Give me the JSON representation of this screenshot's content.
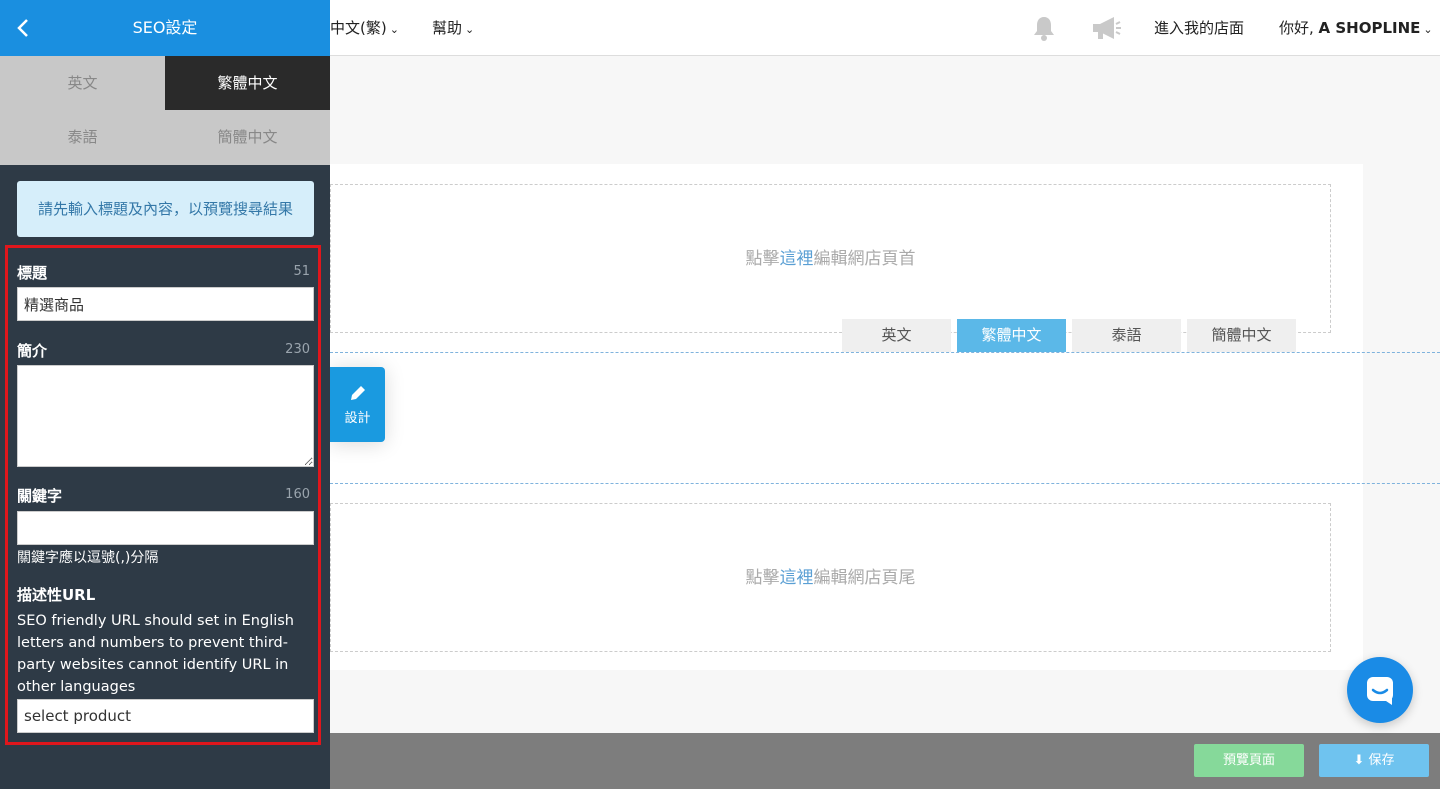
{
  "topbar": {
    "language": "中文(繁)",
    "help": "幫助",
    "enter_store": "進入我的店面",
    "greeting_prefix": "你好, ",
    "greeting_name": "A SHOPLINE"
  },
  "side_panel": {
    "title": "SEO設定",
    "tabs": [
      {
        "label": "英文",
        "active": false
      },
      {
        "label": "繁體中文",
        "active": true
      },
      {
        "label": "泰語",
        "active": false
      },
      {
        "label": "簡體中文",
        "active": false
      }
    ],
    "info": "請先輸入標題及內容，以預覽搜尋結果",
    "fields": {
      "title": {
        "label": "標題",
        "count": "51",
        "value": "精選商品"
      },
      "description": {
        "label": "簡介",
        "count": "230",
        "value": ""
      },
      "keywords": {
        "label": "關鍵字",
        "count": "160",
        "value": "",
        "hint": "關鍵字應以逗號(,)分隔"
      },
      "url": {
        "label": "描述性URL",
        "description": "SEO friendly URL should set in English letters and numbers to prevent third-party websites cannot identify URL in other languages",
        "value": "select product"
      }
    }
  },
  "canvas": {
    "header_prefix": "點擊",
    "header_link": "這裡",
    "header_suffix": "編輯網店頁首",
    "footer_prefix": "點擊",
    "footer_link": "這裡",
    "footer_suffix": "編輯網店頁尾",
    "lang_tabs": [
      {
        "label": "英文",
        "active": false
      },
      {
        "label": "繁體中文",
        "active": true
      },
      {
        "label": "泰語",
        "active": false
      },
      {
        "label": "簡體中文",
        "active": false
      }
    ],
    "design_button": "設計"
  },
  "bottombar": {
    "preview": "預覽頁面",
    "save": "保存"
  },
  "colors": {
    "accent": "#1a8fe0",
    "highlight_frame": "#e0161c",
    "panel_bg": "#2e3a46"
  }
}
